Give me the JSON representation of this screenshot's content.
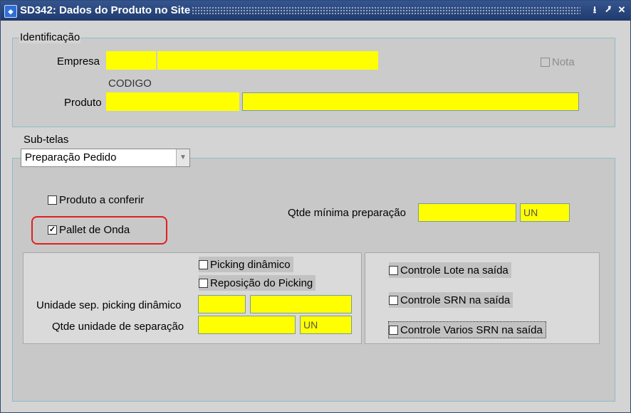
{
  "window": {
    "title": "SD342: Dados do Produto no Site",
    "icon_name": "oracle-forms-icon",
    "buttons": [
      {
        "name": "minimize-icon",
        "glyph": "⭳"
      },
      {
        "name": "maximize-icon",
        "glyph": "⭷"
      },
      {
        "name": "close-icon",
        "glyph": "✕"
      }
    ]
  },
  "identificacao": {
    "group_label": "Identificação",
    "empresa_label": "Empresa",
    "empresa_code": "",
    "empresa_name": "",
    "nota_label": "Nota",
    "codigo_header": "CODIGO",
    "produto_label": "Produto",
    "produto_code": "",
    "produto_desc": ""
  },
  "subtelas": {
    "label": "Sub-telas",
    "selected": "Preparação Pedido"
  },
  "preparacao": {
    "produto_a_conferir": {
      "label": "Produto a conferir",
      "checked": false
    },
    "pallet_de_onda": {
      "label": "Pallet de Onda",
      "checked": true
    },
    "qtde_minima_label": "Qtde mínima preparação",
    "qtde_minima_value": "",
    "qtde_minima_unit": "UN"
  },
  "picking": {
    "picking_dinamico": {
      "label": "Picking dinâmico",
      "checked": false
    },
    "reposicao_picking": {
      "label": "Reposição do Picking",
      "checked": false
    },
    "unidade_sep_label": "Unidade sep. picking dinâmico",
    "unidade_sep_code": "",
    "unidade_sep_desc": "",
    "qtde_unidade_label": "Qtde unidade de separação",
    "qtde_unidade_value": "",
    "qtde_unidade_unit": "UN"
  },
  "controles": {
    "lote": {
      "label": "Controle Lote na saída",
      "checked": false
    },
    "srn": {
      "label": "Controle SRN na saída",
      "checked": false
    },
    "varios_srn": {
      "label": "Controle Varios SRN na saída",
      "checked": false
    }
  },
  "colors": {
    "title_bar": "#1f3a6c",
    "field_fill": "#ffff00",
    "highlight": "#e02020"
  }
}
